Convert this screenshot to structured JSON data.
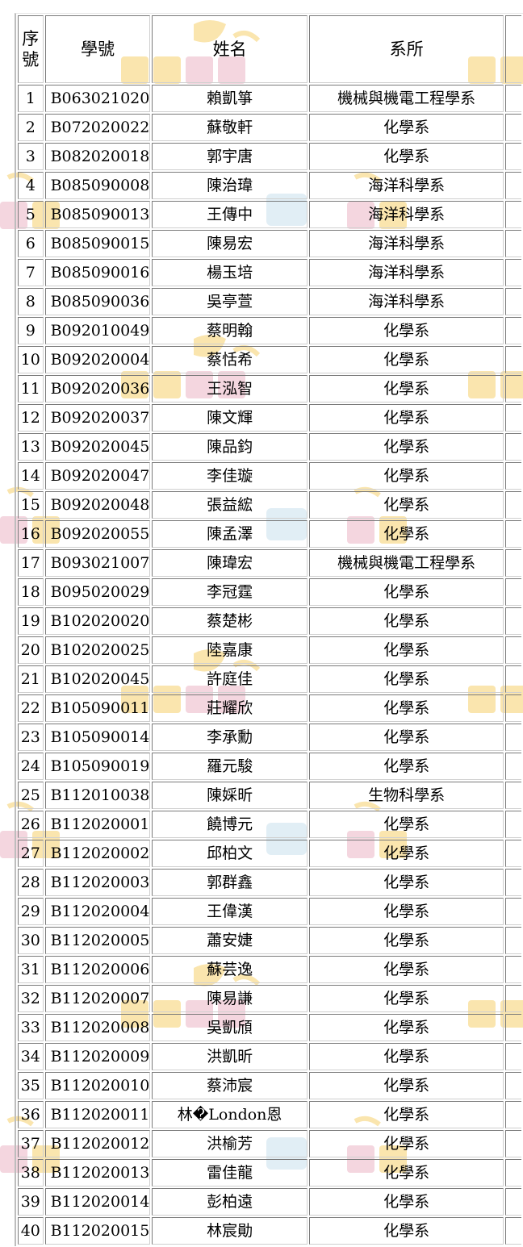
{
  "headers": {
    "no": "序號",
    "id": "學號",
    "name": "姓名",
    "dept": "系所"
  },
  "rows": [
    {
      "no": "1",
      "id": "B063021020",
      "name": "賴凱箏",
      "dept": "機械與機電工程學系"
    },
    {
      "no": "2",
      "id": "B072020022",
      "name": "蘇敬軒",
      "dept": "化學系"
    },
    {
      "no": "3",
      "id": "B082020018",
      "name": "郭宇唐",
      "dept": "化學系"
    },
    {
      "no": "4",
      "id": "B085090008",
      "name": "陳治瑋",
      "dept": "海洋科學系"
    },
    {
      "no": "5",
      "id": "B085090013",
      "name": "王傳中",
      "dept": "海洋科學系"
    },
    {
      "no": "6",
      "id": "B085090015",
      "name": "陳易宏",
      "dept": "海洋科學系"
    },
    {
      "no": "7",
      "id": "B085090016",
      "name": "楊玉培",
      "dept": "海洋科學系"
    },
    {
      "no": "8",
      "id": "B085090036",
      "name": "吳亭萱",
      "dept": "海洋科學系"
    },
    {
      "no": "9",
      "id": "B092010049",
      "name": "蔡明翰",
      "dept": "化學系"
    },
    {
      "no": "10",
      "id": "B092020004",
      "name": "蔡恬希",
      "dept": "化學系"
    },
    {
      "no": "11",
      "id": "B092020036",
      "name": "王泓智",
      "dept": "化學系"
    },
    {
      "no": "12",
      "id": "B092020037",
      "name": "陳文輝",
      "dept": "化學系"
    },
    {
      "no": "13",
      "id": "B092020045",
      "name": "陳品鈞",
      "dept": "化學系"
    },
    {
      "no": "14",
      "id": "B092020047",
      "name": "李佳璇",
      "dept": "化學系"
    },
    {
      "no": "15",
      "id": "B092020048",
      "name": "張益綋",
      "dept": "化學系"
    },
    {
      "no": "16",
      "id": "B092020055",
      "name": "陳孟澤",
      "dept": "化學系"
    },
    {
      "no": "17",
      "id": "B093021007",
      "name": "陳瑋宏",
      "dept": "機械與機電工程學系"
    },
    {
      "no": "18",
      "id": "B095020029",
      "name": "李冠霆",
      "dept": "化學系"
    },
    {
      "no": "19",
      "id": "B102020020",
      "name": "蔡楚彬",
      "dept": "化學系"
    },
    {
      "no": "20",
      "id": "B102020025",
      "name": "陸嘉康",
      "dept": "化學系"
    },
    {
      "no": "21",
      "id": "B102020045",
      "name": "許庭佳",
      "dept": "化學系"
    },
    {
      "no": "22",
      "id": "B105090011",
      "name": "莊耀欣",
      "dept": "化學系"
    },
    {
      "no": "23",
      "id": "B105090014",
      "name": "李承勳",
      "dept": "化學系"
    },
    {
      "no": "24",
      "id": "B105090019",
      "name": "羅元駿",
      "dept": "化學系"
    },
    {
      "no": "25",
      "id": "B112010038",
      "name": "陳婇昕",
      "dept": "生物科學系"
    },
    {
      "no": "26",
      "id": "B112020001",
      "name": "饒博元",
      "dept": "化學系"
    },
    {
      "no": "27",
      "id": "B112020002",
      "name": "邱柏文",
      "dept": "化學系"
    },
    {
      "no": "28",
      "id": "B112020003",
      "name": "郭群鑫",
      "dept": "化學系"
    },
    {
      "no": "29",
      "id": "B112020004",
      "name": "王偉漢",
      "dept": "化學系"
    },
    {
      "no": "30",
      "id": "B112020005",
      "name": "蕭安婕",
      "dept": "化學系"
    },
    {
      "no": "31",
      "id": "B112020006",
      "name": "蘇芸逸",
      "dept": "化學系"
    },
    {
      "no": "32",
      "id": "B112020007",
      "name": "陳易謙",
      "dept": "化學系"
    },
    {
      "no": "33",
      "id": "B112020008",
      "name": "吳凱頎",
      "dept": "化學系"
    },
    {
      "no": "34",
      "id": "B112020009",
      "name": "洪凱昕",
      "dept": "化學系"
    },
    {
      "no": "35",
      "id": "B112020010",
      "name": "蔡沛宸",
      "dept": "化學系"
    },
    {
      "no": "36",
      "id": "B112020011",
      "name": "林�London恩",
      "dept": "化學系"
    },
    {
      "no": "37",
      "id": "B112020012",
      "name": "洪榆芳",
      "dept": "化學系"
    },
    {
      "no": "38",
      "id": "B112020013",
      "name": "雷佳龍",
      "dept": "化學系"
    },
    {
      "no": "39",
      "id": "B112020014",
      "name": "彭柏遠",
      "dept": "化學系"
    },
    {
      "no": "40",
      "id": "B112020015",
      "name": "林宸勛",
      "dept": "化學系"
    }
  ],
  "watermark": {
    "colors": [
      "#f3c64a",
      "#e7a3b8",
      "#bcd8e8"
    ]
  }
}
